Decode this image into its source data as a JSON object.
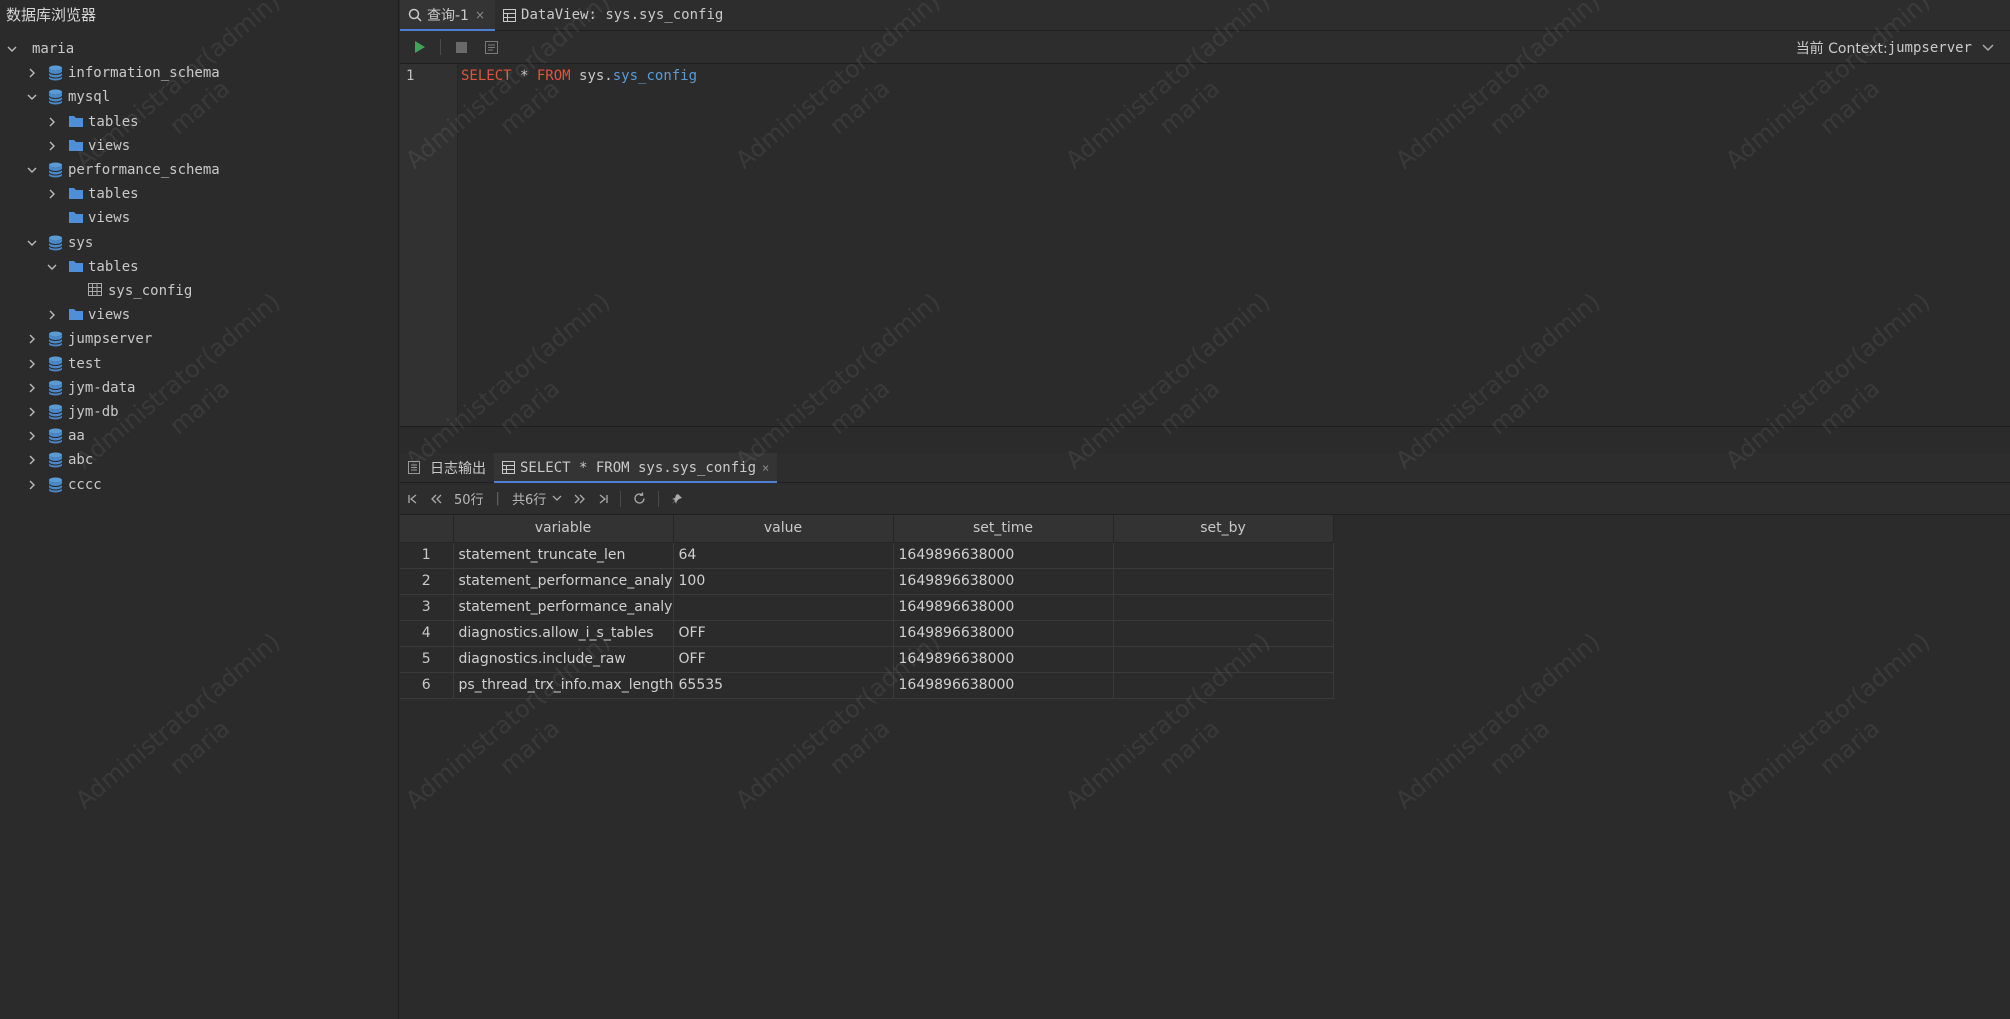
{
  "sidebar": {
    "title": "数据库浏览器",
    "tree": [
      {
        "label": "maria",
        "level": 0,
        "chevron": "down",
        "icon": "none"
      },
      {
        "label": "information_schema",
        "level": 1,
        "chevron": "right",
        "icon": "database"
      },
      {
        "label": "mysql",
        "level": 1,
        "chevron": "down",
        "icon": "database"
      },
      {
        "label": "tables",
        "level": 2,
        "chevron": "right",
        "icon": "folder"
      },
      {
        "label": "views",
        "level": 2,
        "chevron": "right",
        "icon": "folder"
      },
      {
        "label": "performance_schema",
        "level": 1,
        "chevron": "down",
        "icon": "database"
      },
      {
        "label": "tables",
        "level": 2,
        "chevron": "right",
        "icon": "folder"
      },
      {
        "label": "views",
        "level": 2,
        "chevron": "none",
        "icon": "folder"
      },
      {
        "label": "sys",
        "level": 1,
        "chevron": "down",
        "icon": "database"
      },
      {
        "label": "tables",
        "level": 2,
        "chevron": "down",
        "icon": "folder"
      },
      {
        "label": "sys_config",
        "level": 3,
        "chevron": "none",
        "icon": "table"
      },
      {
        "label": "views",
        "level": 2,
        "chevron": "right",
        "icon": "folder"
      },
      {
        "label": "jumpserver",
        "level": 1,
        "chevron": "right",
        "icon": "database"
      },
      {
        "label": "test",
        "level": 1,
        "chevron": "right",
        "icon": "database"
      },
      {
        "label": "jym-data",
        "level": 1,
        "chevron": "right",
        "icon": "database"
      },
      {
        "label": "jym-db",
        "level": 1,
        "chevron": "right",
        "icon": "database"
      },
      {
        "label": "aa",
        "level": 1,
        "chevron": "right",
        "icon": "database"
      },
      {
        "label": "abc",
        "level": 1,
        "chevron": "right",
        "icon": "database"
      },
      {
        "label": "cccc",
        "level": 1,
        "chevron": "right",
        "icon": "database"
      }
    ]
  },
  "tabs": [
    {
      "label": "查询-1",
      "icon": "search-icon",
      "close": "×"
    },
    {
      "label": "DataView: sys.sys_config",
      "icon": "table-icon",
      "close": ""
    }
  ],
  "toolbar": {
    "context_prefix": "当前 Context: ",
    "context_value": "jumpserver"
  },
  "editor": {
    "line_number": "1",
    "tokens": {
      "select": "SELECT",
      "star": " * ",
      "from": "FROM",
      "schema": " sys.",
      "table": "sys_config"
    }
  },
  "result_tabs": [
    {
      "label": "日志输出",
      "icon": "log-icon"
    },
    {
      "label": "SELECT * FROM sys.sys_config",
      "icon": "table-icon",
      "close": "×"
    }
  ],
  "result_toolbar": {
    "page_size": "50行",
    "total": "共6行"
  },
  "grid": {
    "columns": [
      "variable",
      "value",
      "set_time",
      "set_by"
    ],
    "rows": [
      {
        "n": "1",
        "variable": "statement_truncate_len",
        "value": "64",
        "set_time": "1649896638000",
        "set_by": ""
      },
      {
        "n": "2",
        "variable": "statement_performance_analyzer.limit",
        "value": "100",
        "set_time": "1649896638000",
        "set_by": ""
      },
      {
        "n": "3",
        "variable": "statement_performance_analyzer.view",
        "value": "",
        "set_time": "1649896638000",
        "set_by": ""
      },
      {
        "n": "4",
        "variable": "diagnostics.allow_i_s_tables",
        "value": "OFF",
        "set_time": "1649896638000",
        "set_by": ""
      },
      {
        "n": "5",
        "variable": "diagnostics.include_raw",
        "value": "OFF",
        "set_time": "1649896638000",
        "set_by": ""
      },
      {
        "n": "6",
        "variable": "ps_thread_trx_info.max_length",
        "value": "65535",
        "set_time": "1649896638000",
        "set_by": ""
      }
    ]
  },
  "watermark": {
    "line1": "Administrator(admin)",
    "line2": "maria"
  },
  "colors": {
    "accent": "#4a7fd4",
    "keyword": "#e0553c",
    "table_ref": "#5b9bd5",
    "run_green": "#3fa35a",
    "db_icon": "#5b9bd5",
    "folder_icon": "#4e8fd8"
  }
}
